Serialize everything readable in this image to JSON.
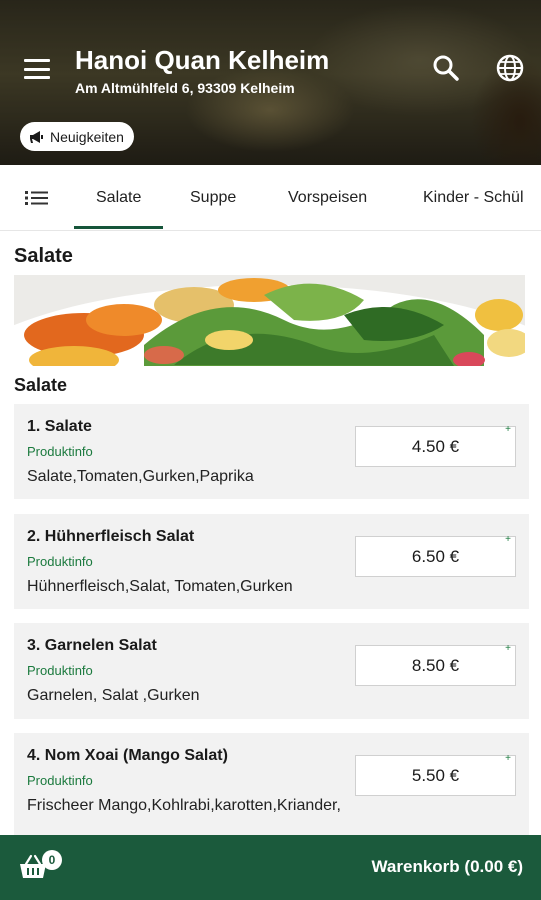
{
  "header": {
    "title": "Hanoi Quan Kelheim",
    "address": "Am Altmühlfeld 6, 93309 Kelheim",
    "news_label": "Neuigkeiten"
  },
  "tabs": {
    "items": [
      "Salate",
      "Suppe",
      "Vorspeisen",
      "Kinder - Schül"
    ],
    "active": "Salate"
  },
  "section": {
    "title": "Salate",
    "subtitle": "Salate"
  },
  "products": [
    {
      "name": "1. Salate",
      "info": "Produktinfo",
      "desc": "Salate,Tomaten,Gurken,Paprika",
      "price": "4.50 €",
      "plus": "+"
    },
    {
      "name": "2. Hühnerfleisch Salat",
      "info": "Produktinfo",
      "desc": "Hühnerfleisch,Salat, Tomaten,Gurken",
      "price": "6.50 €",
      "plus": "+"
    },
    {
      "name": "3. Garnelen Salat",
      "info": "Produktinfo",
      "desc": "Garnelen, Salat ,Gurken",
      "price": "8.50 €",
      "plus": "+"
    },
    {
      "name": "4. Nom Xoai (Mango Salat)",
      "info": "Produktinfo",
      "desc": "Frischeer Mango,Kohlrabi,karotten,Kriander,",
      "price": "5.50 €",
      "plus": "+"
    }
  ],
  "cart": {
    "count": "0",
    "label": "Warenkorb (0.00 €)"
  },
  "colors": {
    "brand_green": "#1b5a3c",
    "info_green": "#1b7a3e"
  }
}
